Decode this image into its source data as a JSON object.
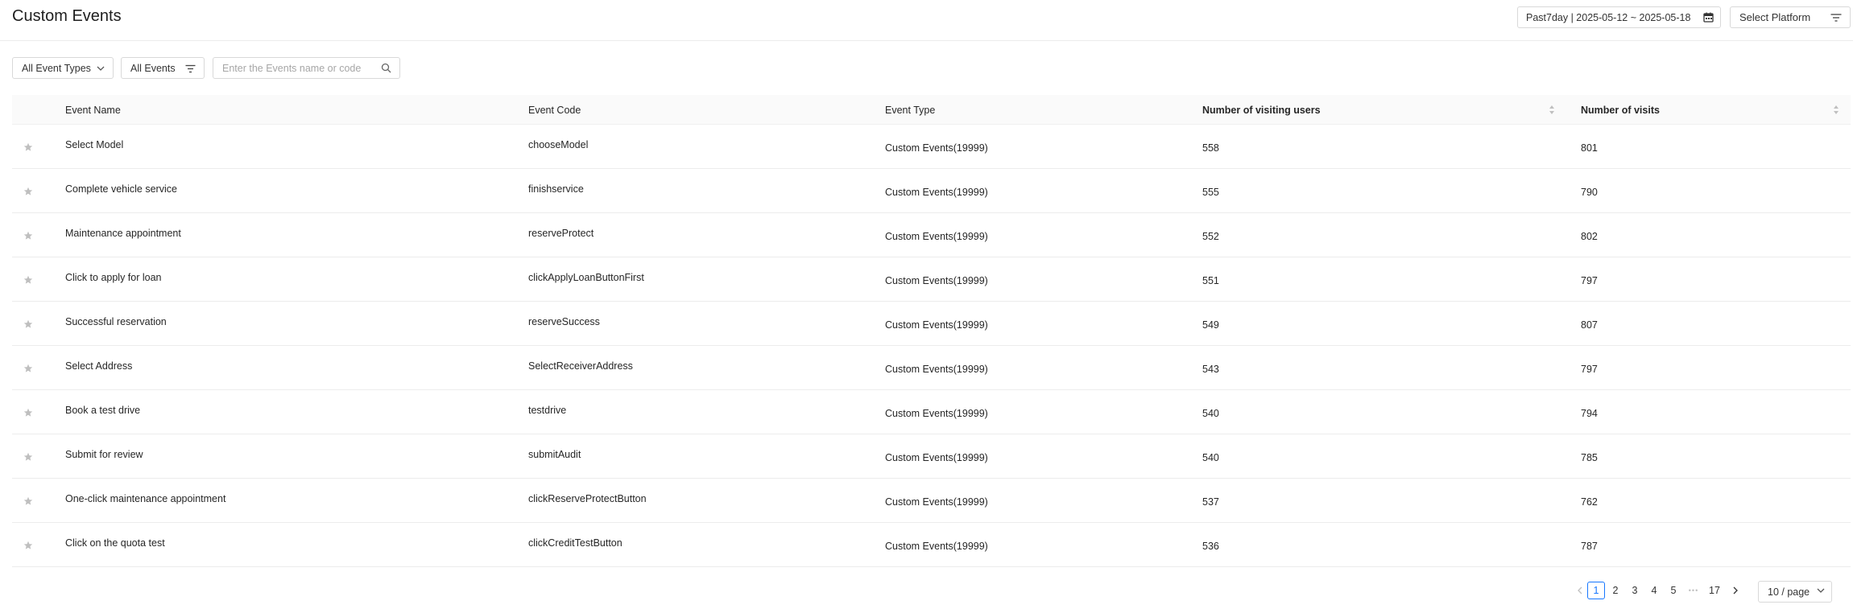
{
  "header": {
    "title": "Custom Events",
    "date_range": "Past7day | 2025-05-12 ~ 2025-05-18",
    "platform_label": "Select Platform"
  },
  "toolbar": {
    "event_types_label": "All Event Types",
    "all_events_label": "All Events",
    "search_placeholder": "Enter the Events name or code"
  },
  "table": {
    "columns": [
      "Event Name",
      "Event Code",
      "Event Type",
      "Number of visiting users",
      "Number of visits"
    ],
    "rows": [
      {
        "name": "Select Model",
        "code": "chooseModel",
        "type": "Custom Events(19999)",
        "users": "558",
        "visits": "801"
      },
      {
        "name": "Complete vehicle service",
        "code": "finishservice",
        "type": "Custom Events(19999)",
        "users": "555",
        "visits": "790"
      },
      {
        "name": "Maintenance appointment",
        "code": "reserveProtect",
        "type": "Custom Events(19999)",
        "users": "552",
        "visits": "802"
      },
      {
        "name": "Click to apply for loan",
        "code": "clickApplyLoanButtonFirst",
        "type": "Custom Events(19999)",
        "users": "551",
        "visits": "797"
      },
      {
        "name": "Successful reservation",
        "code": "reserveSuccess",
        "type": "Custom Events(19999)",
        "users": "549",
        "visits": "807"
      },
      {
        "name": "Select Address",
        "code": "SelectReceiverAddress",
        "type": "Custom Events(19999)",
        "users": "543",
        "visits": "797"
      },
      {
        "name": "Book a test drive",
        "code": "testdrive",
        "type": "Custom Events(19999)",
        "users": "540",
        "visits": "794"
      },
      {
        "name": "Submit for review",
        "code": "submitAudit",
        "type": "Custom Events(19999)",
        "users": "540",
        "visits": "785"
      },
      {
        "name": "One-click maintenance appointment",
        "code": "clickReserveProtectButton",
        "type": "Custom Events(19999)",
        "users": "537",
        "visits": "762"
      },
      {
        "name": "Click on the quota test",
        "code": "clickCreditTestButton",
        "type": "Custom Events(19999)",
        "users": "536",
        "visits": "787"
      }
    ]
  },
  "pagination": {
    "pages": [
      "1",
      "2",
      "3",
      "4",
      "5"
    ],
    "ellipsis": "•••",
    "last_page": "17",
    "current": "1",
    "page_size": "10 / page"
  },
  "colors": {
    "accent": "#1677ff",
    "border": "#d9d9d9",
    "header_bg": "#fafafa",
    "star": "#bfbfbf"
  },
  "icons": {
    "calendar": "calendar-icon",
    "filter": "filter-icon",
    "search": "search-icon",
    "star": "star-icon",
    "sort": "sort-icon",
    "chevron": "chevron-down-icon"
  }
}
